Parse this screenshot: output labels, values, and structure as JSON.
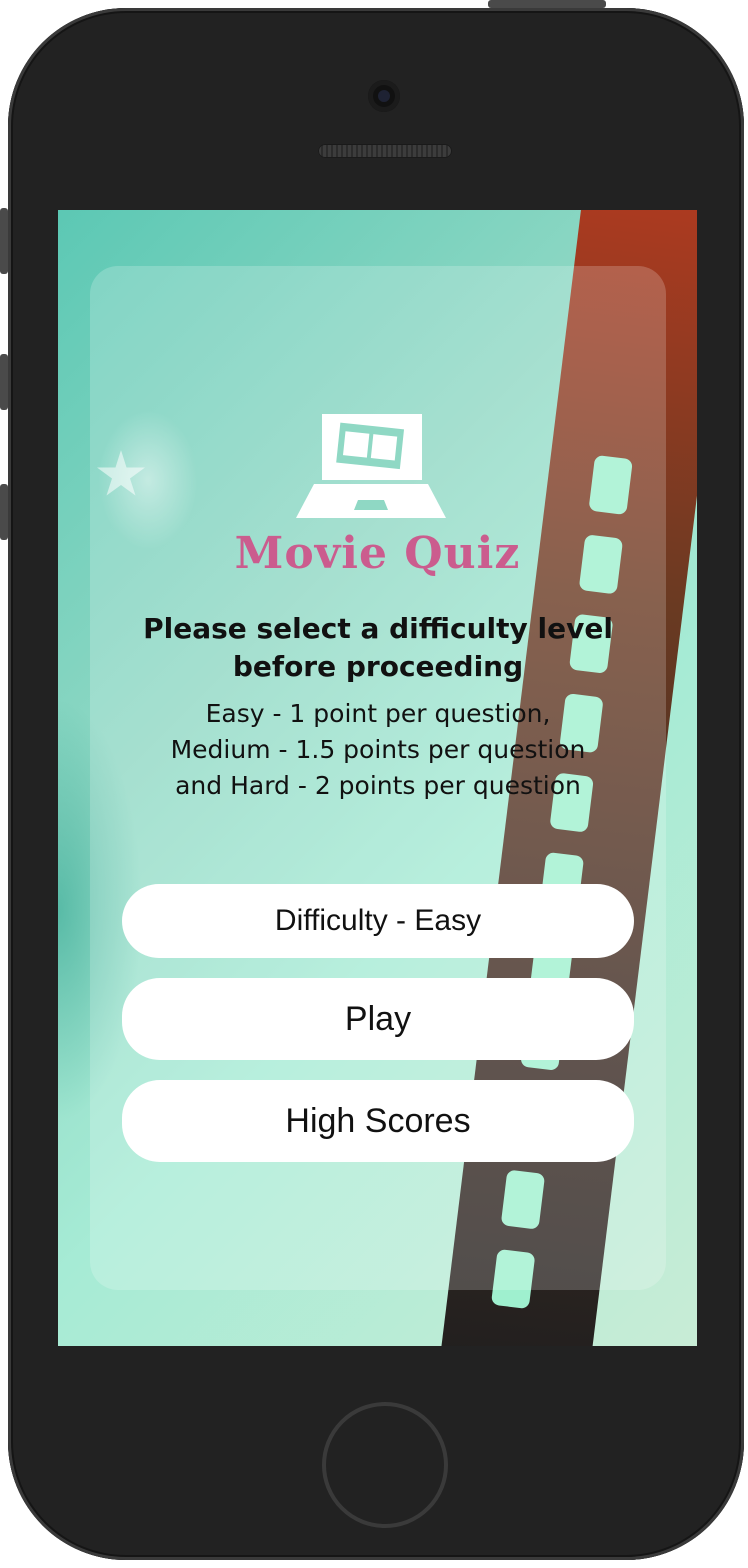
{
  "app": {
    "title": "Movie Quiz"
  },
  "intro": {
    "heading": "Please select a difficulty level before proceeding",
    "description_lines": [
      "Easy - 1 point per question,",
      "Medium - 1.5 points per question",
      "and Hard - 2 points per question"
    ]
  },
  "buttons": {
    "difficulty": "Difficulty - Easy",
    "play": "Play",
    "high_scores": "High Scores"
  },
  "icons": {
    "logo": "laptop-film-icon"
  },
  "colors": {
    "title": "#cb5c8e",
    "background_teal": "#5cc8b4",
    "background_mint": "#a6ebd5",
    "button": "#ffffff",
    "phone_body": "#222222"
  }
}
